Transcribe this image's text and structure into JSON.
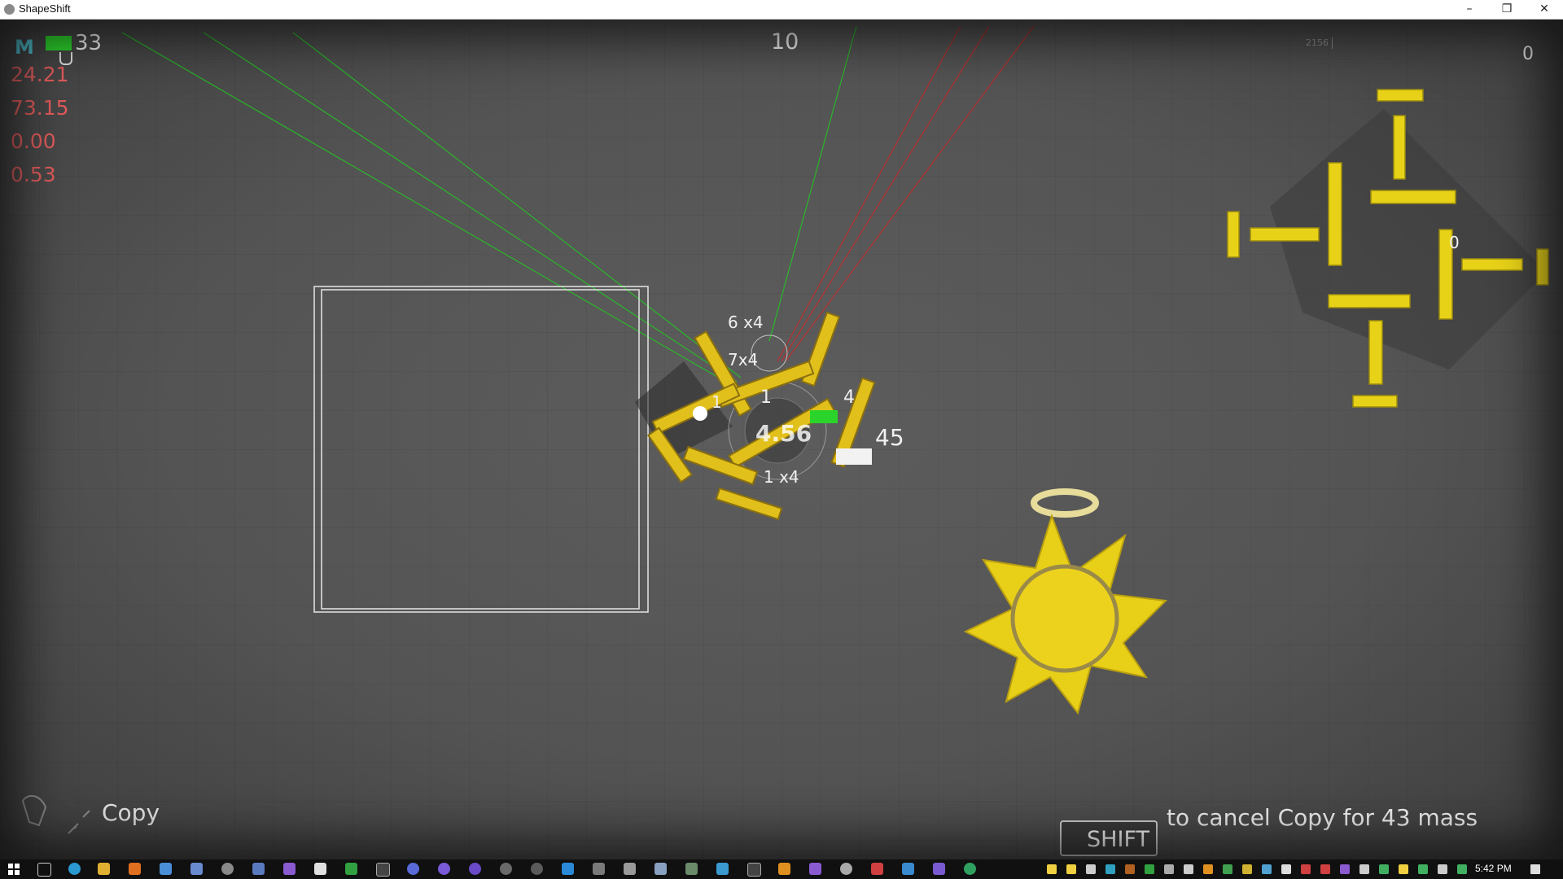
{
  "window": {
    "title": "ShapeShift",
    "minimize_glyph": "–",
    "restore_glyph": "❐",
    "close_glyph": "✕"
  },
  "hud": {
    "mode_icon_letter": "M",
    "player_count": "33",
    "mass_bar_color": "#2bd42b",
    "stats": [
      "24.21",
      "73.15",
      "0.00",
      "0.53"
    ],
    "stat_color": "#e05a5a",
    "center_score": "10",
    "top_right_counter": "0",
    "top_right_small_text": "2156",
    "minimap_marker": "0"
  },
  "ship_labels": {
    "l1": "6 x4",
    "l2": "7x4",
    "l3": "1",
    "l4": "1",
    "l5": "4",
    "l6": "4.56",
    "l7": "45",
    "l8": "1 x4"
  },
  "bottom_left": {
    "action_label": "Copy"
  },
  "bottom_right": {
    "key_label": "SHIFT",
    "hint_text": "to cancel Copy for 43 mass"
  },
  "taskbar": {
    "clock": "5:42 PM"
  },
  "colors": {
    "part_yellow": "#e8c51a",
    "sun_yellow": "#ecd21c",
    "laser_green": "#22c822",
    "laser_red": "#c82828"
  }
}
